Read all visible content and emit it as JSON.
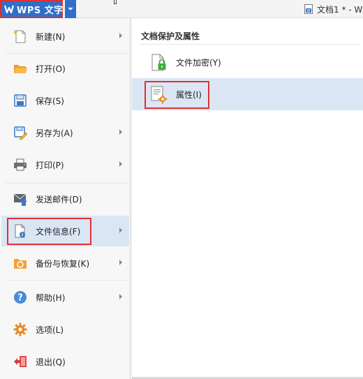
{
  "app": {
    "button_label": "WPS 文字",
    "logo_letter": "W",
    "document_tab": "文档1 * - W"
  },
  "menu": {
    "items": [
      {
        "id": "new",
        "label": "新建(N)",
        "icon": "new-document-icon",
        "has_submenu": true
      },
      {
        "id": "open",
        "label": "打开(O)",
        "icon": "open-folder-icon",
        "has_submenu": false
      },
      {
        "id": "save",
        "label": "保存(S)",
        "icon": "save-icon",
        "has_submenu": false
      },
      {
        "id": "save-as",
        "label": "另存为(A)",
        "icon": "save-as-icon",
        "has_submenu": true
      },
      {
        "id": "print",
        "label": "打印(P)",
        "icon": "printer-icon",
        "has_submenu": true
      },
      {
        "id": "send-mail",
        "label": "发送邮件(D)",
        "icon": "mail-icon",
        "has_submenu": false
      },
      {
        "id": "file-info",
        "label": "文件信息(F)",
        "icon": "file-info-icon",
        "has_submenu": true,
        "active": true
      },
      {
        "id": "backup",
        "label": "备份与恢复(K)",
        "icon": "backup-folder-icon",
        "has_submenu": true
      },
      {
        "id": "help",
        "label": "帮助(H)",
        "icon": "help-icon",
        "has_submenu": true
      },
      {
        "id": "options",
        "label": "选项(L)",
        "icon": "gear-icon",
        "has_submenu": false
      },
      {
        "id": "exit",
        "label": "退出(Q)",
        "icon": "exit-icon",
        "has_submenu": false
      }
    ]
  },
  "panel": {
    "title": "文档保护及属性",
    "items": [
      {
        "label": "文件加密(Y)",
        "icon": "encrypt-document-icon",
        "active": false
      },
      {
        "label": "属性(I)",
        "icon": "properties-icon",
        "active": true
      }
    ]
  },
  "colors": {
    "accent_blue": "#2f6fc9",
    "highlight_red": "#e03030",
    "selected_bg": "#dbe6f5"
  }
}
